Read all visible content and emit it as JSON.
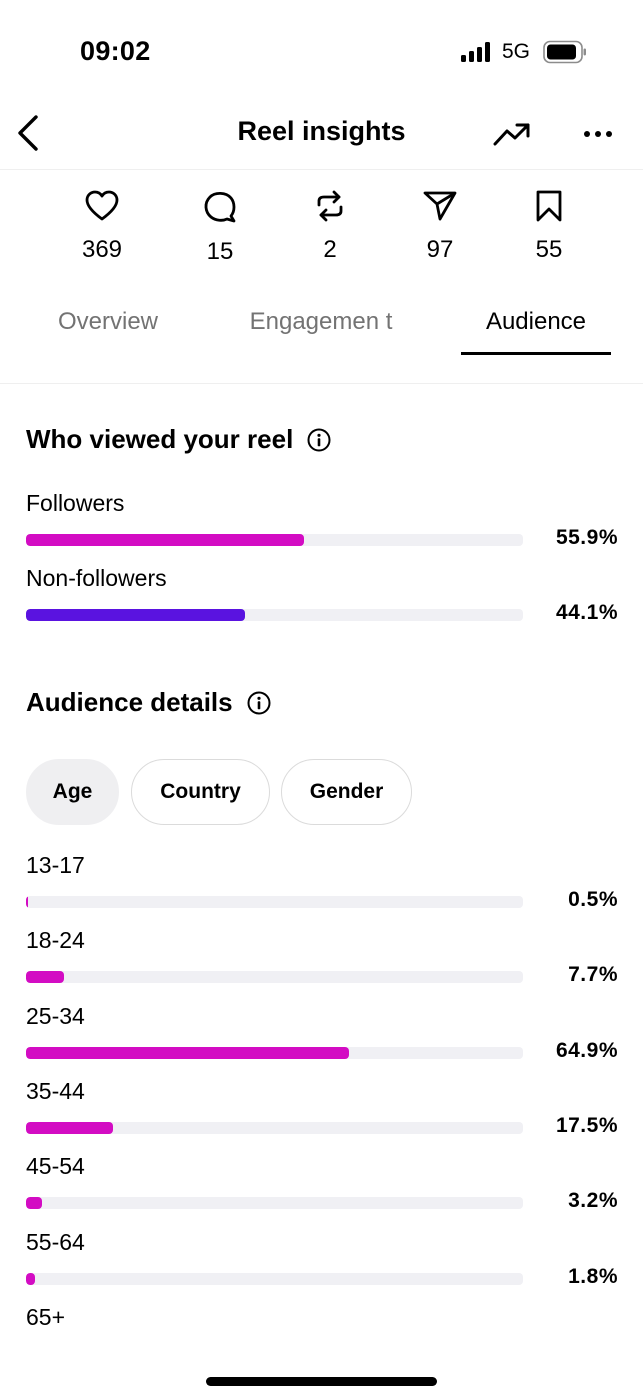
{
  "status": {
    "time": "09:02",
    "network": "5G"
  },
  "header": {
    "title": "Reel insights",
    "icons": {
      "back": "chevron-left-icon",
      "trend": "trending-up-icon",
      "more": "more-horizontal-icon"
    }
  },
  "metrics": [
    {
      "icon": "heart-icon",
      "value": "369"
    },
    {
      "icon": "comment-icon",
      "value": "15"
    },
    {
      "icon": "repost-icon",
      "value": "2"
    },
    {
      "icon": "share-icon",
      "value": "97"
    },
    {
      "icon": "bookmark-icon",
      "value": "55"
    }
  ],
  "tabs": [
    {
      "label": "Overview",
      "active": false
    },
    {
      "label": "Engagemen t",
      "active": false
    },
    {
      "label": "Audience",
      "active": true
    }
  ],
  "who_viewed": {
    "title": "Who viewed your reel",
    "rows": [
      {
        "label": "Followers",
        "value": "55.9%",
        "fraction": 0.559,
        "color": "#d30cc3"
      },
      {
        "label": "Non-followers",
        "value": "44.1%",
        "fraction": 0.441,
        "color": "#5a13e0"
      }
    ]
  },
  "audience": {
    "title": "Audience details",
    "chips": [
      {
        "label": "Age",
        "selected": true
      },
      {
        "label": "Country",
        "selected": false
      },
      {
        "label": "Gender",
        "selected": false
      }
    ],
    "bar_color": "#d30cc3",
    "rows": [
      {
        "label": "13-17",
        "value": "0.5%",
        "fraction": 0.005
      },
      {
        "label": "18-24",
        "value": "7.7%",
        "fraction": 0.077
      },
      {
        "label": "25-34",
        "value": "64.9%",
        "fraction": 0.649
      },
      {
        "label": "35-44",
        "value": "17.5%",
        "fraction": 0.175
      },
      {
        "label": "45-54",
        "value": "3.2%",
        "fraction": 0.032
      },
      {
        "label": "55-64",
        "value": "1.8%",
        "fraction": 0.018
      },
      {
        "label": "65+"
      }
    ]
  }
}
